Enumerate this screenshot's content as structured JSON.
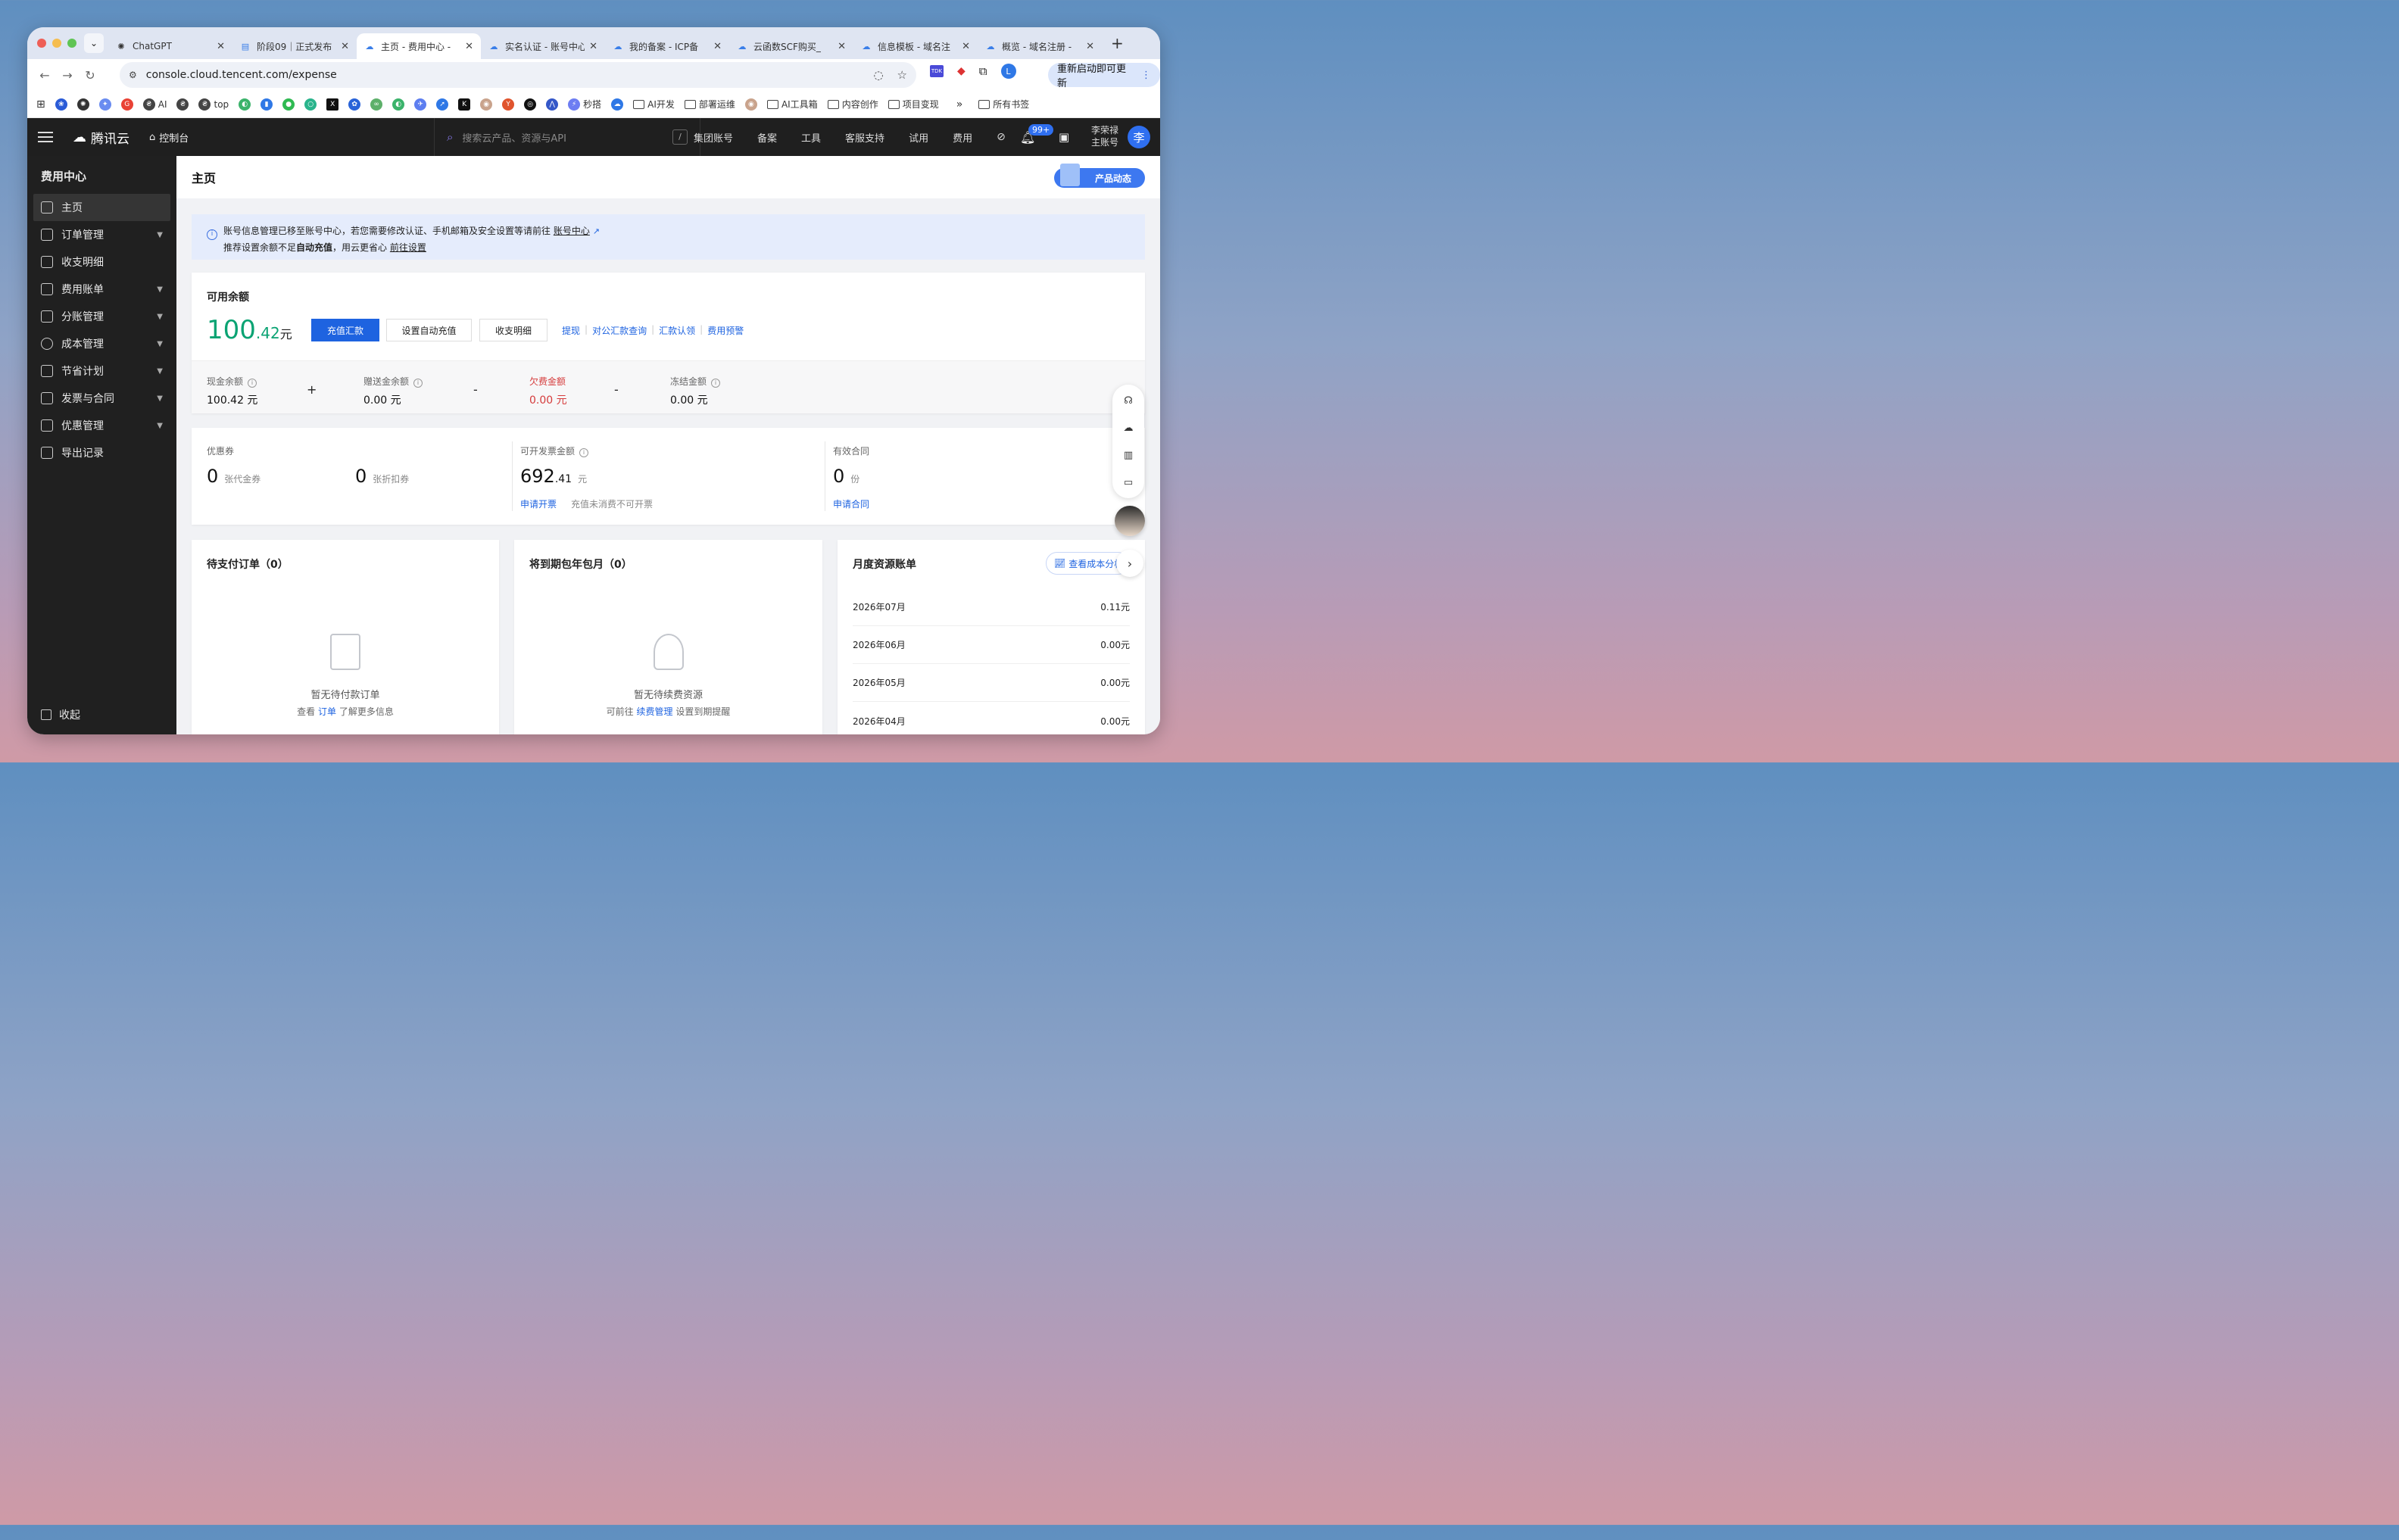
{
  "tabs": [
    {
      "title": "ChatGPT",
      "icon": "openai-icon"
    },
    {
      "title": "阶段09｜正式发布",
      "icon": "doc-icon"
    },
    {
      "title": "主页 - 费用中心 -",
      "icon": "tencent-cloud-icon",
      "active": true
    },
    {
      "title": "实名认证 - 账号中心",
      "icon": "tencent-cloud-icon"
    },
    {
      "title": "我的备案 - ICP备",
      "icon": "tencent-cloud-icon"
    },
    {
      "title": "云函数SCF购买_",
      "icon": "tencent-cloud-icon"
    },
    {
      "title": "信息模板 - 域名注",
      "icon": "tencent-cloud-icon"
    },
    {
      "title": "概览 - 域名注册 -",
      "icon": "tencent-cloud-icon"
    }
  ],
  "address": {
    "url": "console.cloud.tencent.com/expense",
    "update_label": "重新启动即可更新",
    "profile_letter": "L",
    "ext_label": "TDK"
  },
  "bookmarks": {
    "items": [
      "AI",
      "top",
      "秒搭",
      "AI开发",
      "部署运维",
      "AI工具箱",
      "内容创作",
      "项目变现"
    ],
    "more": "»",
    "all": "所有书签"
  },
  "header": {
    "logo": "腾讯云",
    "console": "控制台",
    "search_placeholder": "搜索云产品、资源与API",
    "search_key": "/",
    "nav": [
      "集团账号",
      "备案",
      "工具",
      "客服支持",
      "试用",
      "费用"
    ],
    "badge": "99+",
    "user_name": "李荣禄",
    "user_role": "主账号",
    "avatar": "李"
  },
  "sidebar": {
    "title": "费用中心",
    "items": [
      {
        "label": "主页",
        "expand": false,
        "active": true
      },
      {
        "label": "订单管理",
        "expand": true
      },
      {
        "label": "收支明细",
        "expand": false
      },
      {
        "label": "费用账单",
        "expand": true
      },
      {
        "label": "分账管理",
        "expand": true
      },
      {
        "label": "成本管理",
        "expand": true
      },
      {
        "label": "节省计划",
        "expand": true
      },
      {
        "label": "发票与合同",
        "expand": true
      },
      {
        "label": "优惠管理",
        "expand": true
      },
      {
        "label": "导出记录",
        "expand": false
      }
    ],
    "collapse": "收起"
  },
  "main": {
    "title": "主页",
    "product_news": "产品动态",
    "notice": {
      "line1": "账号信息管理已移至账号中心，若您需要修改认证、手机邮箱及安全设置等请前往",
      "link1": "账号中心",
      "line2a": "推荐设置余额不足",
      "line2b": "自动充值",
      "line2c": "，用云更省心",
      "link2": "前往设置"
    },
    "balance": {
      "label": "可用余额",
      "int": "100",
      "dec": ".42",
      "unit": "元",
      "buttons": {
        "recharge": "充值汇款",
        "auto": "设置自动充值",
        "detail": "收支明细"
      },
      "links": [
        "提现",
        "对公汇款查询",
        "汇款认领",
        "费用预警"
      ],
      "cols": [
        {
          "label": "现金余额",
          "value": "100.42 元"
        },
        {
          "label": "赠送金余额",
          "value": "0.00 元"
        },
        {
          "label": "欠费金额",
          "value": "0.00 元"
        },
        {
          "label": "冻结金额",
          "value": "0.00 元"
        }
      ],
      "ops": [
        "+",
        "-",
        "-"
      ]
    },
    "stats": {
      "coupon_label": "优惠券",
      "coupon_cash": "0",
      "coupon_cash_unit": "张代金券",
      "coupon_disc": "0",
      "coupon_disc_unit": "张折扣券",
      "invoice_label": "可开发票金额",
      "invoice_int": "692",
      "invoice_dec": ".41",
      "invoice_unit": "元",
      "invoice_link": "申请开票",
      "invoice_note": "充值未消费不可开票",
      "contract_label": "有效合同",
      "contract_val": "0",
      "contract_unit": "份",
      "contract_link": "申请合同"
    },
    "pending": {
      "title": "待支付订单（0）",
      "empty": "暂无待付款订单",
      "hint_a": "查看",
      "hint_link": "订单",
      "hint_b": "了解更多信息"
    },
    "renew": {
      "title": "将到期包年包月（0）",
      "empty": "暂无待续费资源",
      "hint_a": "可前往",
      "hint_link": "续费管理",
      "hint_b": "设置到期提醒"
    },
    "monthly": {
      "title": "月度资源账单",
      "cost_btn": "查看成本分析",
      "rows": [
        {
          "month": "2026年07月",
          "amount": "0.11元"
        },
        {
          "month": "2026年06月",
          "amount": "0.00元"
        },
        {
          "month": "2026年05月",
          "amount": "0.00元"
        },
        {
          "month": "2026年04月",
          "amount": "0.00元"
        }
      ]
    }
  },
  "colors": {
    "accent": "#1e63e0",
    "balance_green": "#0aa373",
    "debt_red": "#d53b3b"
  }
}
